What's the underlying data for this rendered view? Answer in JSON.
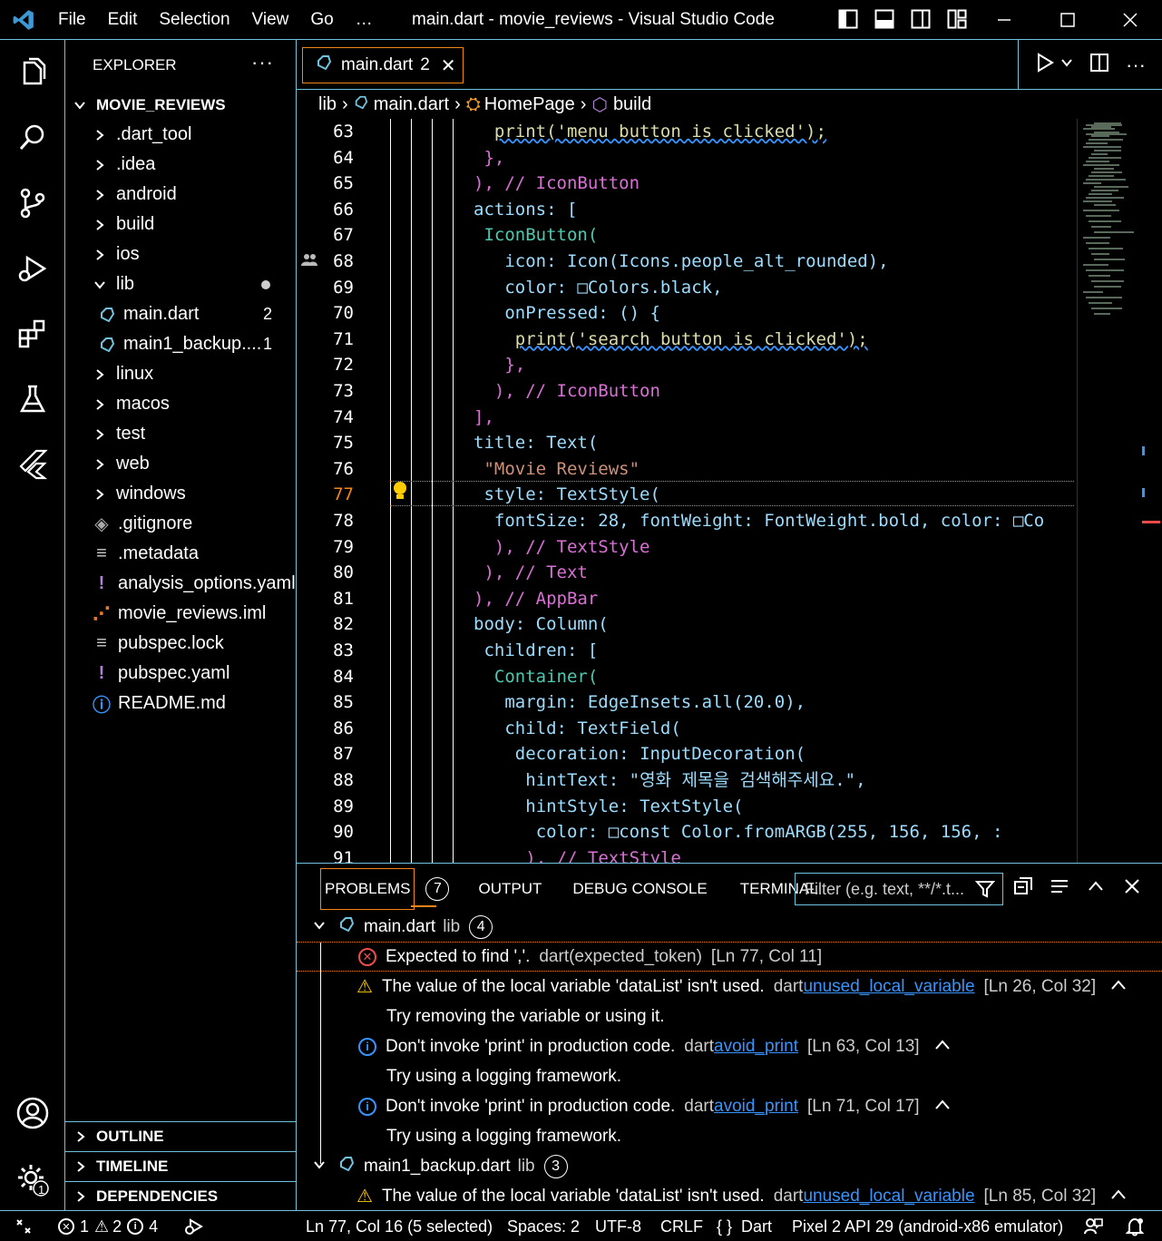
{
  "titlebar": {
    "menus": [
      "File",
      "Edit",
      "Selection",
      "View",
      "Go",
      "…"
    ],
    "window_title": "main.dart - movie_reviews - Visual Studio Code"
  },
  "sidebar": {
    "title": "EXPLORER",
    "root": "MOVIE_REVIEWS",
    "items": [
      {
        "label": ".dart_tool",
        "type": "folder"
      },
      {
        "label": ".idea",
        "type": "folder"
      },
      {
        "label": "android",
        "type": "folder"
      },
      {
        "label": "build",
        "type": "folder"
      },
      {
        "label": "ios",
        "type": "folder"
      },
      {
        "label": "lib",
        "type": "folder-open"
      },
      {
        "label": "main.dart",
        "type": "dart",
        "badge": "2"
      },
      {
        "label": "main1_backup....",
        "type": "dart",
        "badge": "1"
      },
      {
        "label": "linux",
        "type": "folder"
      },
      {
        "label": "macos",
        "type": "folder"
      },
      {
        "label": "test",
        "type": "folder"
      },
      {
        "label": "web",
        "type": "folder"
      },
      {
        "label": "windows",
        "type": "folder"
      },
      {
        "label": ".gitignore",
        "type": "git"
      },
      {
        "label": ".metadata",
        "type": "lines"
      },
      {
        "label": "analysis_options.yaml",
        "type": "yaml"
      },
      {
        "label": "movie_reviews.iml",
        "type": "rss"
      },
      {
        "label": "pubspec.lock",
        "type": "lines"
      },
      {
        "label": "pubspec.yaml",
        "type": "yaml"
      },
      {
        "label": "README.md",
        "type": "info"
      }
    ],
    "sections": [
      "OUTLINE",
      "TIMELINE",
      "DEPENDENCIES"
    ]
  },
  "tab": {
    "label": "main.dart",
    "count": "2"
  },
  "breadcrumb": [
    "lib",
    "main.dart",
    "HomePage",
    "build"
  ],
  "code": {
    "active_line": "77",
    "lines": [
      "63",
      "64",
      "65",
      "66",
      "67",
      "68",
      "69",
      "70",
      "71",
      "72",
      "73",
      "74",
      "75",
      "76",
      "77",
      "78",
      "79",
      "80",
      "81",
      "82",
      "83",
      "84",
      "85",
      "86",
      "87",
      "88",
      "89",
      "90",
      "91"
    ],
    "t63": "print('menu button is clicked');",
    "t64": "},",
    "t65": "), // IconButton",
    "t66": "actions: [",
    "t67": "IconButton(",
    "t68": "icon: Icon(Icons.people_alt_rounded),",
    "t69": "color: □Colors.black,",
    "t70": "onPressed: () {",
    "t71": "print('search button is clicked');",
    "t72": "},",
    "t73": "), // IconButton",
    "t74": "],",
    "t75": "title: Text(",
    "t76": "\"Movie Reviews\"",
    "t77": "style: TextStyle(",
    "t78": "fontSize: 28, fontWeight: FontWeight.bold, color: □Co",
    "t79": "), // TextStyle",
    "t80": "), // Text",
    "t81": "), // AppBar",
    "t82": "body: Column(",
    "t83": "children: [",
    "t84": "Container(",
    "t85": "margin: EdgeInsets.all(20.0),",
    "t86": "child: TextField(",
    "t87": "decoration: InputDecoration(",
    "t88": "hintText: \"영화 제목을 검색해주세요.\",",
    "t89": "hintStyle: TextStyle(",
    "t90": "color: □const Color.fromARGB(255, 156, 156, :",
    "t91": "), // TextStyle"
  },
  "panel": {
    "tabs": [
      "PROBLEMS",
      "OUTPUT",
      "DEBUG CONSOLE",
      "TERMINAL"
    ],
    "problems_count": "7",
    "filter_placeholder": "Filter (e.g. text, **/*.t...",
    "files": [
      {
        "name": "main.dart",
        "dir": "lib",
        "count": "4"
      },
      {
        "name": "main1_backup.dart",
        "dir": "lib",
        "count": "3"
      }
    ],
    "problems": [
      {
        "msg": "Expected to find ','.",
        "src": "dart(expected_token)",
        "loc": "[Ln 77, Col 11]"
      },
      {
        "msg": "The value of the local variable 'dataList' isn't used.",
        "src_prefix": "dart",
        "src_link": "unused_local_variable",
        "loc": "[Ln 26, Col 32]",
        "hint": "Try removing the variable or using it."
      },
      {
        "msg": "Don't invoke 'print' in production code.",
        "src_prefix": "dart",
        "src_link": "avoid_print",
        "loc": "[Ln 63, Col 13]",
        "hint": "Try using a logging framework."
      },
      {
        "msg": "Don't invoke 'print' in production code.",
        "src_prefix": "dart",
        "src_link": "avoid_print",
        "loc": "[Ln 71, Col 17]",
        "hint": "Try using a logging framework."
      },
      {
        "msg": "The value of the local variable 'dataList' isn't used.",
        "src_prefix": "dart",
        "src_link": "unused_local_variable",
        "loc": "[Ln 85, Col 32]"
      }
    ]
  },
  "status": {
    "errors": "1",
    "warnings": "2",
    "infos": "4",
    "position": "Ln 77, Col 16 (5 selected)",
    "spaces": "Spaces: 2",
    "encoding": "UTF-8",
    "eol": "CRLF",
    "language": "Dart",
    "device": "Pixel 2 API 29 (android-x86 emulator)"
  },
  "accounts_badge": "1",
  "colors": {
    "accent_border": "#6fc3df",
    "focus_border": "#f38518"
  }
}
